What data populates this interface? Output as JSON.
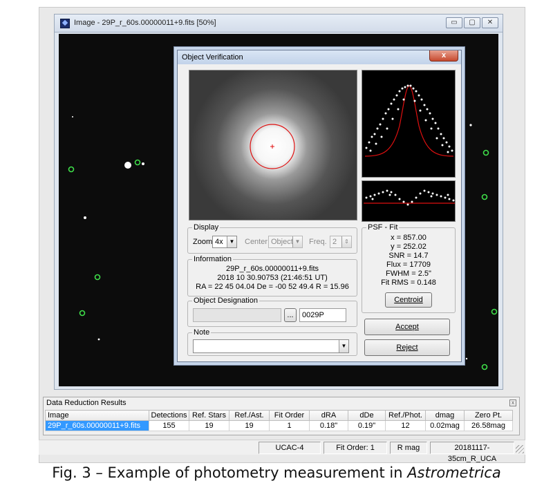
{
  "image_window": {
    "title": "Image - 29P_r_60s.00000011+9.fits [50%]",
    "buttons": {
      "minimize": "▭",
      "maximize": "▢",
      "close": "✕"
    }
  },
  "dialog": {
    "title": "Object Verification",
    "close": "x",
    "display": {
      "legend": "Display",
      "zoom_label": "Zoom",
      "zoom_value": "4x",
      "center_label": "Center",
      "center_value": "Object",
      "freq_label": "Freq.",
      "freq_value": "2"
    },
    "psf": {
      "legend": "PSF - Fit",
      "x": "x = 857.00",
      "y": "y = 252.02",
      "snr": "SNR = 14.7",
      "flux": "Flux = 17709",
      "fwhm": "FWHM = 2.5\"",
      "fit_rms": "Fit RMS = 0.148",
      "centroid_button": "Centroid"
    },
    "information": {
      "legend": "Information",
      "line1": "29P_r_60s.00000011+9.fits",
      "line2": "2018 10 30.90753 (21:46:51 UT)",
      "line3": "RA = 22 45 04.04   De = -00 52 49.4   R = 15.96"
    },
    "designation": {
      "legend": "Object Designation",
      "name_value": "",
      "browse_button": "...",
      "code_value": "0029P"
    },
    "note": {
      "legend": "Note",
      "value": ""
    },
    "accept_button": "Accept",
    "reject_button": "Reject"
  },
  "data_reduction": {
    "title": "Data Reduction Results",
    "close": "x",
    "columns": [
      "Image",
      "Detections",
      "Ref. Stars",
      "Ref./Ast.",
      "Fit Order",
      "dRA",
      "dDe",
      "Ref./Phot.",
      "dmag",
      "Zero Pt."
    ],
    "rows": [
      [
        "29P_r_60s.00000011+9.fits",
        "155",
        "19",
        "19",
        "1",
        "0.18\"",
        "0.19\"",
        "12",
        "0.02mag",
        "26.58mag"
      ]
    ]
  },
  "status_bar": {
    "catalog": "UCAC-4",
    "fit_order": "Fit Order: 1",
    "mag": "R mag",
    "config": "20181117-35cm_R_UCA"
  },
  "caption": {
    "prefix": "Fig. 3 – Example of photometry measurement in ",
    "software": "Astrometrica"
  }
}
